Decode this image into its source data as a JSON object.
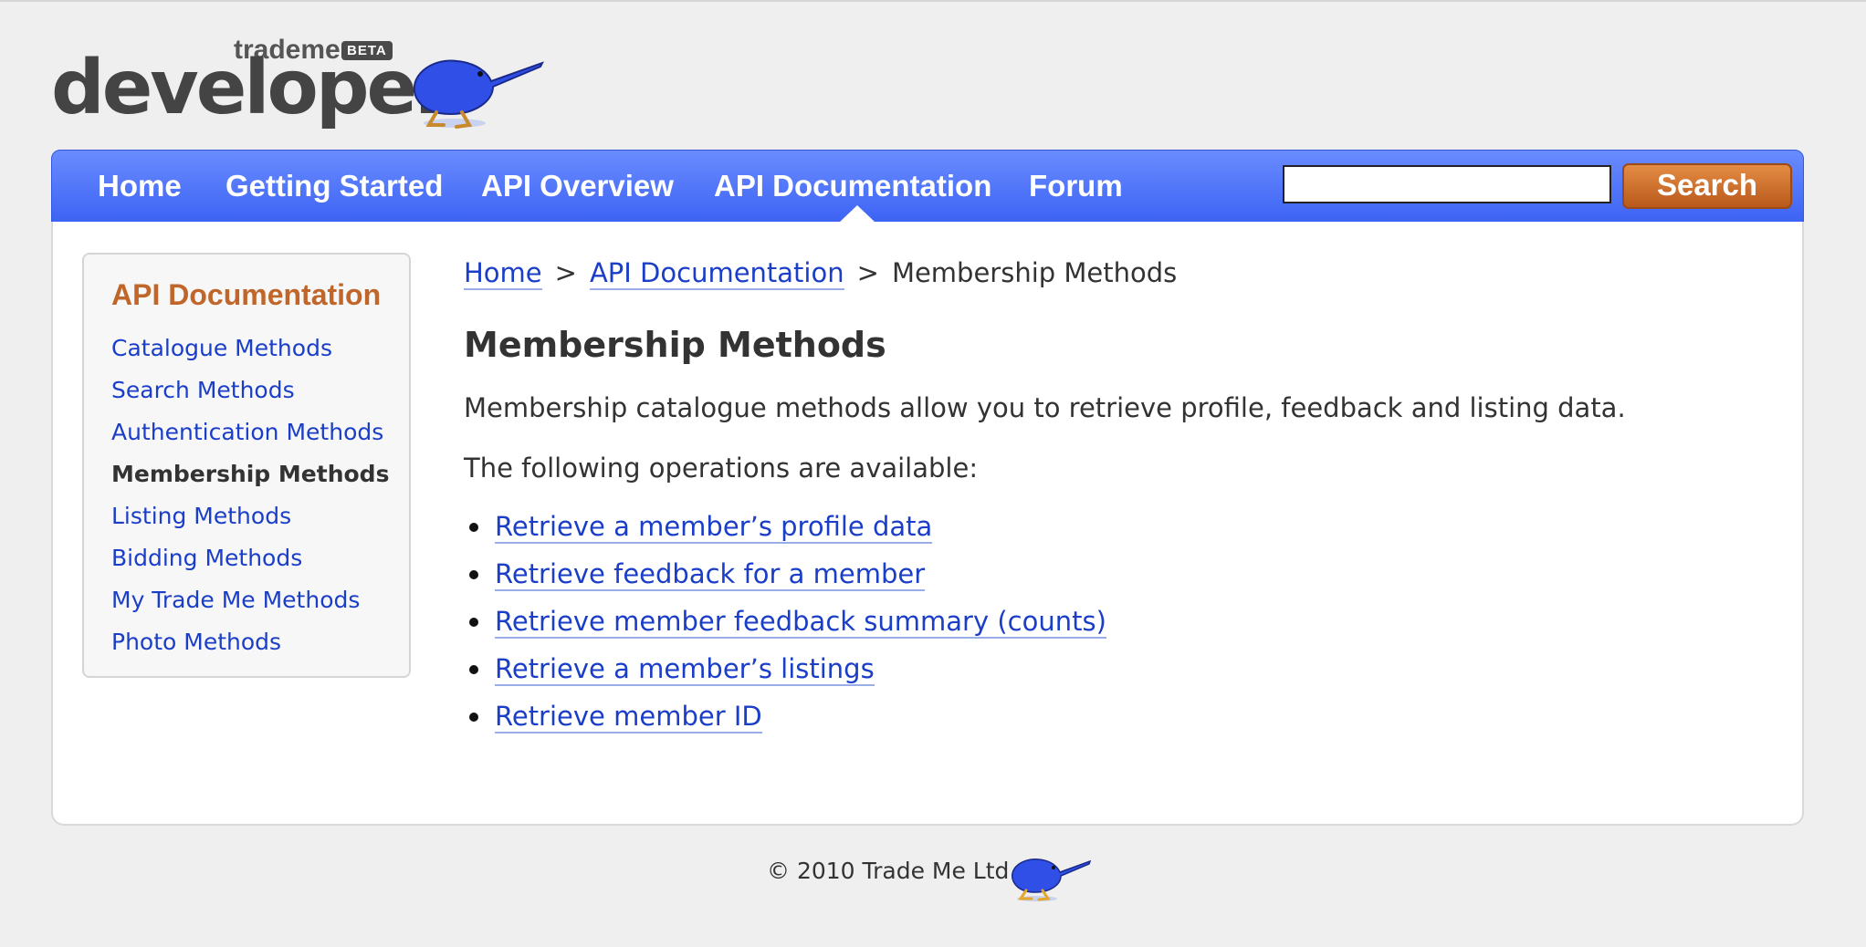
{
  "logo": {
    "wordmark": "developer",
    "brand": "trademe",
    "badge": "BETA",
    "icon": "kiwi-icon"
  },
  "nav": {
    "items": [
      {
        "label": "Home"
      },
      {
        "label": "Getting Started"
      },
      {
        "label": "API Overview"
      },
      {
        "label": "API Documentation"
      },
      {
        "label": "Forum"
      }
    ],
    "active": "API Documentation",
    "search_value": "",
    "search_button": "Search"
  },
  "sidebar": {
    "title": "API Documentation",
    "items": [
      {
        "label": "Catalogue Methods"
      },
      {
        "label": "Search Methods"
      },
      {
        "label": "Authentication Methods"
      },
      {
        "label": "Membership Methods"
      },
      {
        "label": "Listing Methods"
      },
      {
        "label": "Bidding Methods"
      },
      {
        "label": "My Trade Me Methods"
      },
      {
        "label": "Photo Methods"
      }
    ],
    "active": "Membership Methods"
  },
  "breadcrumb": {
    "home": "Home",
    "sep1": ">",
    "section": "API Documentation",
    "sep2": ">",
    "current": "Membership Methods"
  },
  "main": {
    "title": "Membership Methods",
    "intro": "Membership catalogue methods allow you to retrieve profile, feedback and listing data.",
    "ops_heading": "The following operations are available:",
    "operations": [
      {
        "label": "Retrieve a member’s profile data"
      },
      {
        "label": "Retrieve feedback for a member"
      },
      {
        "label": "Retrieve member feedback summary (counts)"
      },
      {
        "label": "Retrieve a member’s listings"
      },
      {
        "label": "Retrieve member ID"
      }
    ]
  },
  "footer": {
    "copyright": "© 2010 Trade Me Ltd"
  },
  "colors": {
    "nav_blue": "#3d63f4",
    "search_orange": "#c4672a",
    "link_blue": "#1a3ec8",
    "sidebar_title": "#c0662a",
    "page_bg": "#efefef"
  }
}
